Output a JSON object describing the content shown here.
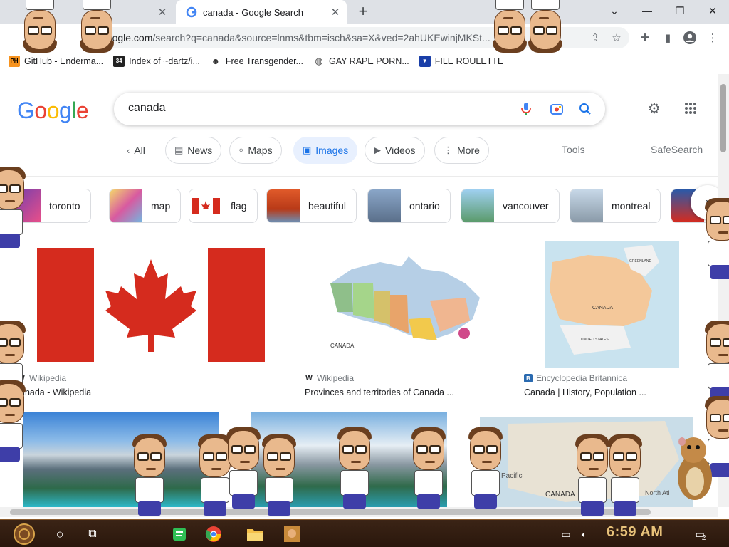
{
  "browser": {
    "tabs": [
      {
        "title": "",
        "active": false
      },
      {
        "title": "canada - Google Search",
        "active": true
      }
    ],
    "url": {
      "host": "google.com",
      "path": "/search?q=canada&source=lnms&tbm=isch&sa=X&ved=2ahUKEwinjMKSt..."
    },
    "bookmarks": [
      {
        "label": "GitHub - Enderma...",
        "icon": "ph-icon",
        "color": "#f7931e"
      },
      {
        "label": "Index of ~dartz/i...",
        "icon": "index-icon",
        "color": "#222222"
      },
      {
        "label": "Free Transgender...",
        "icon": "mask-icon",
        "color": "#444444"
      },
      {
        "label": "GAY RAPE PORN...",
        "icon": "globe-icon",
        "color": "#555555"
      },
      {
        "label": "FILE ROULETTE",
        "icon": "roulette-icon",
        "color": "#1a3fa8"
      }
    ]
  },
  "google": {
    "logo": [
      "G",
      "o",
      "o",
      "g",
      "l",
      "e"
    ],
    "query": "canada",
    "nav": {
      "back": "All",
      "news": "News",
      "maps": "Maps",
      "images": "Images",
      "videos": "Videos",
      "more": "More",
      "tools": "Tools",
      "safesearch": "SafeSearch"
    },
    "related": [
      "toronto",
      "map",
      "flag",
      "beautiful",
      "ontario",
      "vancouver",
      "montreal"
    ],
    "results": [
      {
        "source": "Wikipedia",
        "title": "anada - Wikipedia"
      },
      {
        "source": "Wikipedia",
        "title": "Provinces and territories of Canada ..."
      },
      {
        "source": "Encyclopedia Britannica",
        "title": "Canada | History, Population ..."
      }
    ],
    "map_labels": {
      "political": "CANADA",
      "britannica": "CANADA",
      "britannica_us": "UNITED STATES",
      "britannica_greenland": "GREENLAND",
      "row2": "CANADA",
      "row2_pacific": "Pacific",
      "row2_north": "North Atl"
    }
  },
  "taskbar": {
    "time": "6:59 AM",
    "notifications": "2"
  },
  "colors": {
    "accent": "#1a73e8",
    "flag_red": "#d52b1e",
    "tab_bg": "#dee1e6"
  }
}
